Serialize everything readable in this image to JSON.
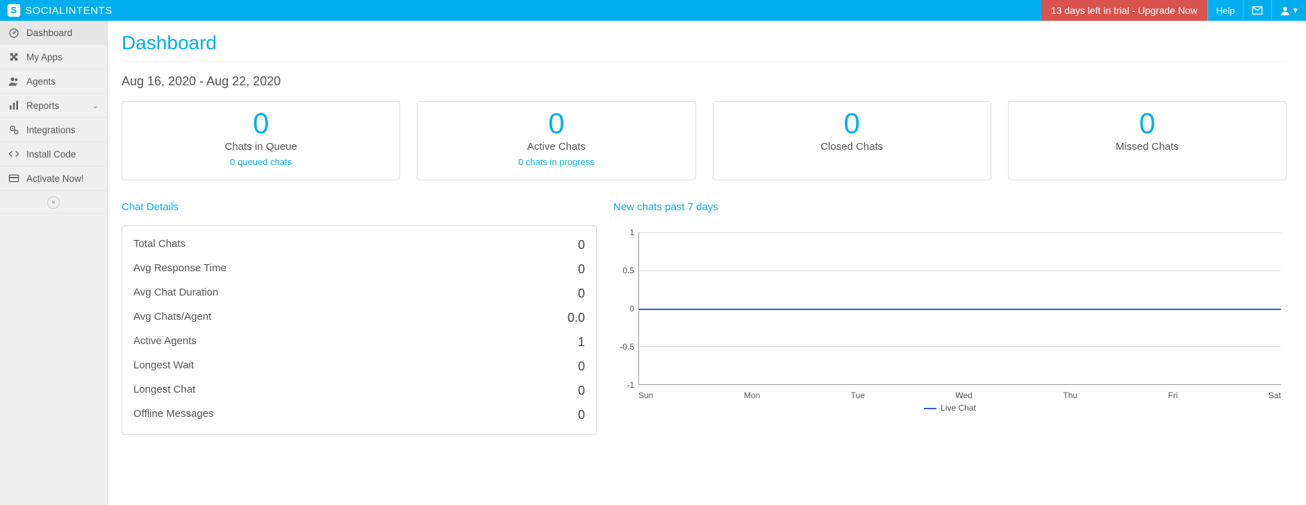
{
  "brand": "SOCIALINTENTS",
  "topbar": {
    "trial": "13 days left in trial - Upgrade Now",
    "help": "Help"
  },
  "sidebar": {
    "items": [
      {
        "label": "Dashboard"
      },
      {
        "label": "My Apps"
      },
      {
        "label": "Agents"
      },
      {
        "label": "Reports"
      },
      {
        "label": "Integrations"
      },
      {
        "label": "Install Code"
      },
      {
        "label": "Activate Now!"
      }
    ]
  },
  "page": {
    "title": "Dashboard",
    "date_range": "Aug 16, 2020 - Aug 22, 2020"
  },
  "cards": [
    {
      "num": "0",
      "label": "Chats in Queue",
      "sub": "0 queued chats"
    },
    {
      "num": "0",
      "label": "Active Chats",
      "sub": "0 chats in progress"
    },
    {
      "num": "0",
      "label": "Closed Chats"
    },
    {
      "num": "0",
      "label": "Missed Chats"
    }
  ],
  "details": {
    "title": "Chat Details",
    "rows": [
      {
        "label": "Total Chats",
        "value": "0"
      },
      {
        "label": "Avg Response Time",
        "value": "0"
      },
      {
        "label": "Avg Chat Duration",
        "value": "0"
      },
      {
        "label": "Avg Chats/Agent",
        "value": "0.0"
      },
      {
        "label": "Active Agents",
        "value": "1"
      },
      {
        "label": "Longest Wait",
        "value": "0"
      },
      {
        "label": "Longest Chat",
        "value": "0"
      },
      {
        "label": "Offline Messages",
        "value": "0"
      }
    ]
  },
  "chart_title": "New chats past 7 days",
  "chart_data": {
    "type": "line",
    "categories": [
      "Sun",
      "Mon",
      "Tue",
      "Wed",
      "Thu",
      "Fri",
      "Sat"
    ],
    "series": [
      {
        "name": "Live Chat",
        "values": [
          0,
          0,
          0,
          0,
          0,
          0,
          0
        ]
      }
    ],
    "ylim": [
      -1.0,
      1.0
    ],
    "yticks": [
      1.0,
      0.5,
      0.0,
      -0.5,
      -1.0
    ],
    "xlabel": "",
    "ylabel": "",
    "title": ""
  }
}
